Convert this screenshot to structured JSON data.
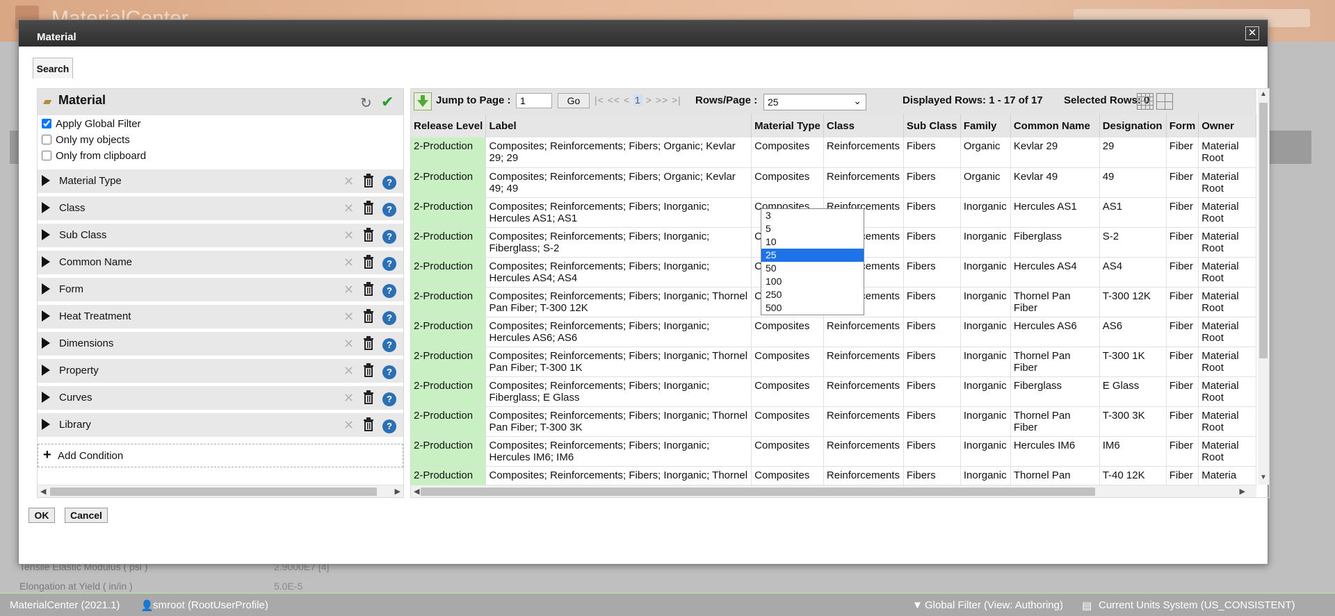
{
  "background": {
    "app_name": "MaterialCenter",
    "search_placeholder": "",
    "properties": [
      {
        "label": "Tensile Elastic Modulus ( psi )",
        "value": "2.9000E7 [4]"
      },
      {
        "label": "Elongation at Yield ( in/in )",
        "value": "5.0E-5"
      }
    ],
    "footer": {
      "version": "MaterialCenter (2021.1)",
      "user": "smroot (RootUserProfile)",
      "global_filter": "Global Filter (View: Authoring)",
      "units": "Current Units System (US_CONSISTENT)"
    }
  },
  "modal": {
    "title": "Material",
    "close_label": "✕",
    "tab_search": "Search",
    "ok_label": "OK",
    "cancel_label": "Cancel"
  },
  "left_panel": {
    "title": "Material",
    "checkboxes": [
      {
        "label": "Apply Global Filter",
        "checked": true
      },
      {
        "label": "Only my objects",
        "checked": false
      },
      {
        "label": "Only from clipboard",
        "checked": false
      }
    ],
    "conditions": [
      "Material Type",
      "Class",
      "Sub Class",
      "Common Name",
      "Form",
      "Heat Treatment",
      "Dimensions",
      "Property",
      "Curves",
      "Library"
    ],
    "add_condition": "Add Condition",
    "help_glyph": "?"
  },
  "toolbar": {
    "jump_label": "Jump to Page :",
    "jump_value": "1",
    "go_label": "Go",
    "pager_text": "|< << <",
    "pager_current": "1",
    "pager_text_after": "> >> >|",
    "rows_label": "Rows/Page :",
    "rows_value": "25",
    "displayed_rows": "Displayed Rows: 1 - 17 of 17",
    "selected_rows": "Selected Rows:  0"
  },
  "rows_dropdown": {
    "options": [
      "3",
      "5",
      "10",
      "25",
      "50",
      "100",
      "250",
      "500"
    ],
    "selected": "25"
  },
  "grid": {
    "columns": [
      "Release Level",
      "Label",
      "Material Type",
      "Class",
      "Sub Class",
      "Family",
      "Common Name",
      "Designation",
      "Form",
      "Owner"
    ],
    "rows": [
      [
        "2-Production",
        "Composites; Reinforcements; Fibers; Organic; Kevlar 29; 29",
        "Composites",
        "Reinforcements",
        "Fibers",
        "Organic",
        "Kevlar 29",
        "29",
        "Fiber",
        "Material Root"
      ],
      [
        "2-Production",
        "Composites; Reinforcements; Fibers; Organic; Kevlar 49; 49",
        "Composites",
        "Reinforcements",
        "Fibers",
        "Organic",
        "Kevlar 49",
        "49",
        "Fiber",
        "Material Root"
      ],
      [
        "2-Production",
        "Composites; Reinforcements; Fibers; Inorganic; Hercules AS1; AS1",
        "Composites",
        "Reinforcements",
        "Fibers",
        "Inorganic",
        "Hercules AS1",
        "AS1",
        "Fiber",
        "Material Root"
      ],
      [
        "2-Production",
        "Composites; Reinforcements; Fibers; Inorganic; Fiberglass; S-2",
        "Composites",
        "Reinforcements",
        "Fibers",
        "Inorganic",
        "Fiberglass",
        "S-2",
        "Fiber",
        "Material Root"
      ],
      [
        "2-Production",
        "Composites; Reinforcements; Fibers; Inorganic; Hercules AS4; AS4",
        "Composites",
        "Reinforcements",
        "Fibers",
        "Inorganic",
        "Hercules AS4",
        "AS4",
        "Fiber",
        "Material Root"
      ],
      [
        "2-Production",
        "Composites; Reinforcements; Fibers; Inorganic; Thornel Pan Fiber; T-300 12K",
        "Composites",
        "Reinforcements",
        "Fibers",
        "Inorganic",
        "Thornel Pan Fiber",
        "T-300 12K",
        "Fiber",
        "Material Root"
      ],
      [
        "2-Production",
        "Composites; Reinforcements; Fibers; Inorganic; Hercules AS6; AS6",
        "Composites",
        "Reinforcements",
        "Fibers",
        "Inorganic",
        "Hercules AS6",
        "AS6",
        "Fiber",
        "Material Root"
      ],
      [
        "2-Production",
        "Composites; Reinforcements; Fibers; Inorganic; Thornel Pan Fiber; T-300 1K",
        "Composites",
        "Reinforcements",
        "Fibers",
        "Inorganic",
        "Thornel Pan Fiber",
        "T-300 1K",
        "Fiber",
        "Material Root"
      ],
      [
        "2-Production",
        "Composites; Reinforcements; Fibers; Inorganic; Fiberglass; E Glass",
        "Composites",
        "Reinforcements",
        "Fibers",
        "Inorganic",
        "Fiberglass",
        "E Glass",
        "Fiber",
        "Material Root"
      ],
      [
        "2-Production",
        "Composites; Reinforcements; Fibers; Inorganic; Thornel Pan Fiber; T-300 3K",
        "Composites",
        "Reinforcements",
        "Fibers",
        "Inorganic",
        "Thornel Pan Fiber",
        "T-300 3K",
        "Fiber",
        "Material Root"
      ],
      [
        "2-Production",
        "Composites; Reinforcements; Fibers; Inorganic; Hercules IM6; IM6",
        "Composites",
        "Reinforcements",
        "Fibers",
        "Inorganic",
        "Hercules IM6",
        "IM6",
        "Fiber",
        "Material Root"
      ],
      [
        "2-Production",
        "Composites; Reinforcements; Fibers; Inorganic; Thornel",
        "Composites",
        "Reinforcements",
        "Fibers",
        "Inorganic",
        "Thornel Pan",
        "T-40 12K",
        "Fiber",
        "Materia"
      ]
    ]
  },
  "colors": {
    "release_level_bg": "#c8f0c2",
    "dropdown_selected": "#1e73e8",
    "help_icon": "#2b6fb5",
    "apply_check": "#2a9a2a"
  }
}
